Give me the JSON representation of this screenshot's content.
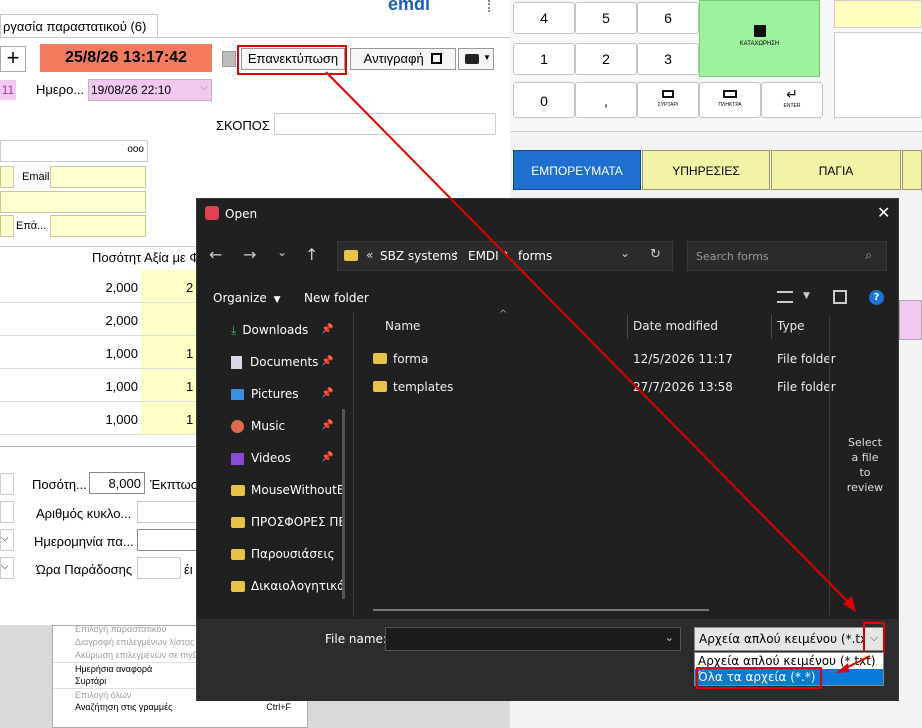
{
  "left_app": {
    "tab_label": "ργασία παραστατικού (6)",
    "datetime": "25/8/26 13:17:42",
    "reprint_label": "Επανεκτύπωση",
    "copy_label": "Αντιγραφή",
    "field_11": "11",
    "date_label": "Ημερο...",
    "date_value": "19/08/26 22:10",
    "purpose_label": "ΣΚΟΠΟΣ",
    "more_indicator": "ooo",
    "email_label": "Email",
    "eta_label": "Επά...",
    "grid": {
      "qty_header": "Ποσότητ",
      "value_header": "Αξία με Φ",
      "rows": [
        {
          "qty": "2,000",
          "val": "2"
        },
        {
          "qty": "2,000",
          "val": ""
        },
        {
          "qty": "1,000",
          "val": "1"
        },
        {
          "qty": "1,000",
          "val": "1"
        },
        {
          "qty": "1,000",
          "val": "1"
        }
      ]
    },
    "bottom": {
      "qty_label": "Ποσότη...",
      "qty_value": "8,000",
      "discount_label": "Έκπτωσ",
      "cycle_label": "Αριθμός κυκλο...",
      "date_label": "Ημερομηνία πα...",
      "time_label": "Ώρα Παράδοσης",
      "time_suffix": "έι"
    },
    "context_menu": [
      {
        "label": "Επιλογή παραστατικού",
        "disabled": true
      },
      {
        "label": "Διαγραφή επιλεγμένων λίστας",
        "disabled": true
      },
      {
        "label": "Ακύρωση επιλεγμένων σε myD...",
        "disabled": true
      },
      {
        "label": "Ημερήσια αναφορά",
        "disabled": false
      },
      {
        "label": "Συρτάρι",
        "disabled": false
      },
      {
        "label": "Επιλογή όλων",
        "disabled": true
      },
      {
        "label": "Αναζήτηση στις γραμμές",
        "disabled": false,
        "shortcut": "Ctrl+F"
      }
    ]
  },
  "pos": {
    "keys_row1": [
      "4",
      "5",
      "6"
    ],
    "keys_row2": [
      "1",
      "2",
      "3"
    ],
    "key_zero": "0",
    "key_comma": ",",
    "save_label": "ΚΑΤΑΧΩΡΗΣΗ",
    "drawer_label": "ΣΥΡΤΑΡΙ",
    "keyboard_label": "ΠΛΗΚΤΡΑ",
    "enter_label": "ENTER",
    "categories": [
      "ΕΜΠΟΡΕΥΜΑΤΑ",
      "ΥΠΗΡΕΣΙΕΣ",
      "ΠΑΓΙΑ"
    ]
  },
  "dialog": {
    "title": "Open",
    "breadcrumb": [
      "SBZ systems",
      "EMDI",
      "forms"
    ],
    "breadcrumb_prefix": "«",
    "search_placeholder": "Search forms",
    "organize_label": "Organize",
    "new_folder_label": "New folder",
    "sidebar": [
      {
        "label": "Downloads",
        "icon": "download-icon",
        "pinned": true
      },
      {
        "label": "Documents",
        "icon": "documents-icon",
        "pinned": true
      },
      {
        "label": "Pictures",
        "icon": "pictures-icon",
        "pinned": true
      },
      {
        "label": "Music",
        "icon": "music-icon",
        "pinned": true
      },
      {
        "label": "Videos",
        "icon": "videos-icon",
        "pinned": true
      },
      {
        "label": "MouseWithoutB",
        "icon": "folder-icon",
        "pinned": false
      },
      {
        "label": "ΠΡΟΣΦΟΡΕΣ ΠΕ",
        "icon": "folder-icon",
        "pinned": false
      },
      {
        "label": "Παρουσιάσεις",
        "icon": "folder-icon",
        "pinned": false
      },
      {
        "label": "Δικαιολογητικά",
        "icon": "folder-icon",
        "pinned": false
      }
    ],
    "columns": {
      "name": "Name",
      "date": "Date modified",
      "type": "Type"
    },
    "files": [
      {
        "name": "forma",
        "date": "12/5/2026 11:17",
        "type": "File folder"
      },
      {
        "name": "templates",
        "date": "27/7/2026 13:58",
        "type": "File folder"
      }
    ],
    "preview_text": "Select a file to review",
    "filename_label": "File name:",
    "filetype_selected": "Αρχεία απλού κειμένου (*.txt)",
    "filetype_options": [
      "Αρχεία απλού κειμένου (*.txt)",
      "Όλα τα αρχεία (*.*)"
    ]
  },
  "colors": {
    "annotation": "#e00000",
    "datetime_bg": "#f47b5e",
    "save_green": "#9ef29e",
    "category_blue": "#1f6fd0",
    "category_yellow": "#f3f3a8",
    "highlight": "#0a78d7"
  }
}
